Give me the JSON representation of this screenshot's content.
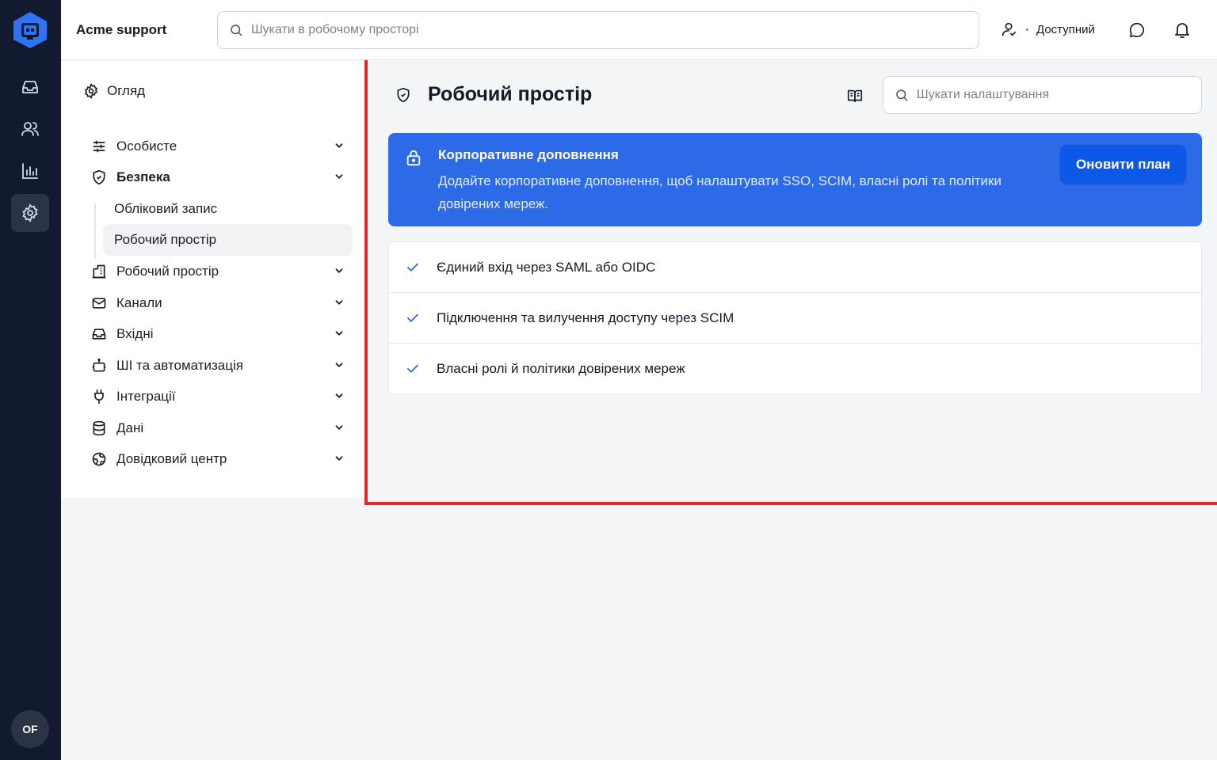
{
  "rail": {
    "items": [
      {
        "icon": "inbox-icon"
      },
      {
        "icon": "users-icon"
      },
      {
        "icon": "chart-icon"
      },
      {
        "icon": "gear-icon",
        "active": true
      }
    ],
    "avatar_initials": "OF"
  },
  "topbar": {
    "org_name": "Acme support",
    "search_placeholder": "Шукати в робочому просторі",
    "status_label": "Доступний"
  },
  "nav": {
    "overview": "Огляд",
    "items": [
      {
        "label": "Особисте",
        "icon": "sliders-icon"
      },
      {
        "label": "Безпека",
        "icon": "shield-icon",
        "expanded": true
      },
      {
        "label": "Робочий простір",
        "icon": "building-icon"
      },
      {
        "label": "Канали",
        "icon": "mail-icon"
      },
      {
        "label": "Вхідні",
        "icon": "inbox-icon"
      },
      {
        "label": "ШІ та автоматизація",
        "icon": "bot-icon"
      },
      {
        "label": "Інтеграції",
        "icon": "plug-icon"
      },
      {
        "label": "Дані",
        "icon": "database-icon"
      },
      {
        "label": "Довідковий центр",
        "icon": "globe-icon"
      }
    ],
    "security_subitems": [
      {
        "label": "Обліковий запис"
      },
      {
        "label": "Робочий простір",
        "active": true
      }
    ]
  },
  "content": {
    "title": "Робочий простір",
    "settings_search_placeholder": "Шукати налаштування",
    "banner": {
      "title": "Корпоративне доповнення",
      "description": "Додайте корпоративне доповнення, щоб налаштувати SSO, SCIM, власні ролі та політики довірених мереж.",
      "button": "Оновити план"
    },
    "features": [
      "Єдиний вхід через SAML або OIDC",
      "Підключення та вилучення доступу через SCIM",
      "Власні ролі й політики довірених мереж"
    ]
  },
  "colors": {
    "rail_bg": "#111a2e",
    "accent": "#2d6ae8",
    "button": "#0e58e8",
    "highlight_frame": "#e3262e"
  }
}
